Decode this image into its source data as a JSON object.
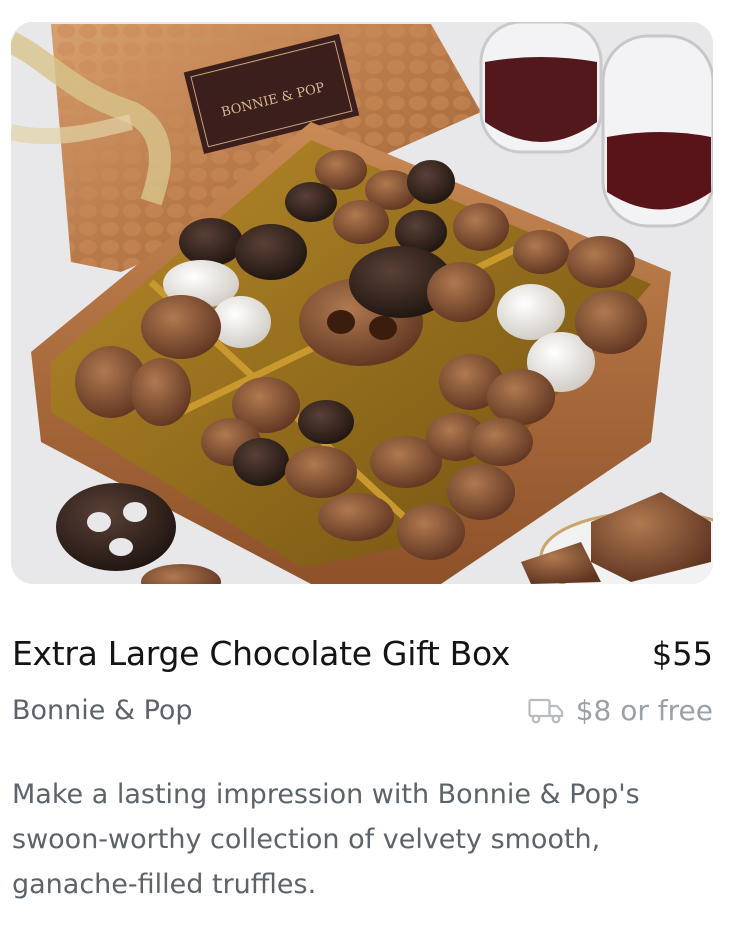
{
  "product": {
    "image_alt": "Chocolate gift box in a copper tin with a pretzel and wine glasses",
    "tin_logo": "BONNIE & POP",
    "title": "Extra Large Chocolate Gift Box",
    "price": "$55",
    "brand": "Bonnie & Pop",
    "shipping": "$8 or free",
    "shipping_icon": "truck-icon",
    "description": "Make a lasting impression with Bonnie & Pop's swoon-worthy collection of velvety smooth, ganache-filled truffles."
  },
  "colors": {
    "title": "#141414",
    "secondary_text": "#5d636b",
    "shipping": "#9aa1a8"
  }
}
